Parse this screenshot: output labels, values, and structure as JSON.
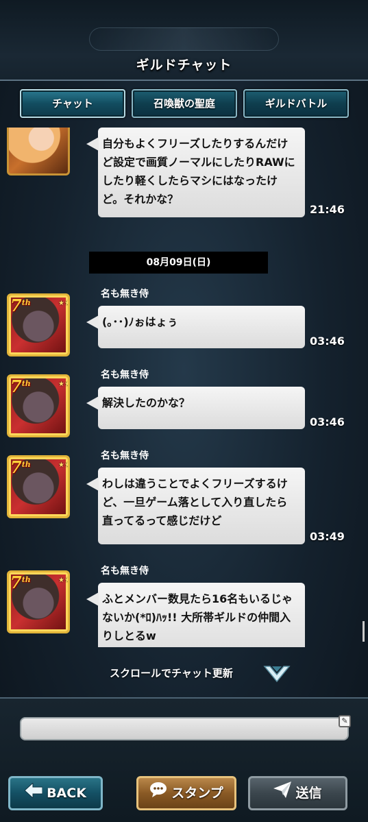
{
  "header": {
    "title": "ギルドチャット"
  },
  "tabs": [
    {
      "label": "チャット"
    },
    {
      "label": "召喚獣の聖庭"
    },
    {
      "label": "ギルドバトル"
    }
  ],
  "messages": [
    {
      "sender": "",
      "avatar": "girl-avatar",
      "text": "自分もよくフリーズしたりするんだけど設定で画質ノーマルにしたりRAWにしたり軽くしたらマシにはなったけど。それかな？",
      "time": "21:46"
    },
    {
      "sender": "名も無き侍",
      "avatar": "samurai-avatar",
      "rank": "7",
      "rank_suffix": "th",
      "text": "(｡･･)ﾉぉはょぅ",
      "time": "03:46"
    },
    {
      "sender": "名も無き侍",
      "avatar": "samurai-avatar",
      "rank": "7",
      "rank_suffix": "th",
      "text": "解決したのかな？",
      "time": "03:46"
    },
    {
      "sender": "名も無き侍",
      "avatar": "samurai-avatar",
      "rank": "7",
      "rank_suffix": "th",
      "text": "わしは違うことでよくフリーズするけど、一旦ゲーム落として入り直したら直ってるって感じだけど",
      "time": "03:49"
    },
    {
      "sender": "名も無き侍",
      "avatar": "samurai-avatar",
      "rank": "7",
      "rank_suffix": "th",
      "text": "ふとメンバー数見たら16名もいるじゃないか(*ﾛ)ﾊｯ!! 大所帯ギルドの仲間入りしとるw",
      "time": ""
    }
  ],
  "date_separator": "08月09日(日)",
  "scroll_hint": "スクロールでチャット更新",
  "input": {
    "value": "",
    "placeholder": ""
  },
  "buttons": {
    "back": "BACK",
    "stamp": "スタンプ",
    "send": "送信"
  },
  "icons": {
    "back": "left-arrow-icon",
    "stamp": "speech-bubble-icon",
    "send": "paper-plane-icon",
    "scroll": "chevron-down-icon",
    "edit": "edit-icon"
  },
  "colors": {
    "bubble": "#e9e9e9",
    "tab_accent": "#1d5f73",
    "stamp_accent": "#8a5a25"
  }
}
